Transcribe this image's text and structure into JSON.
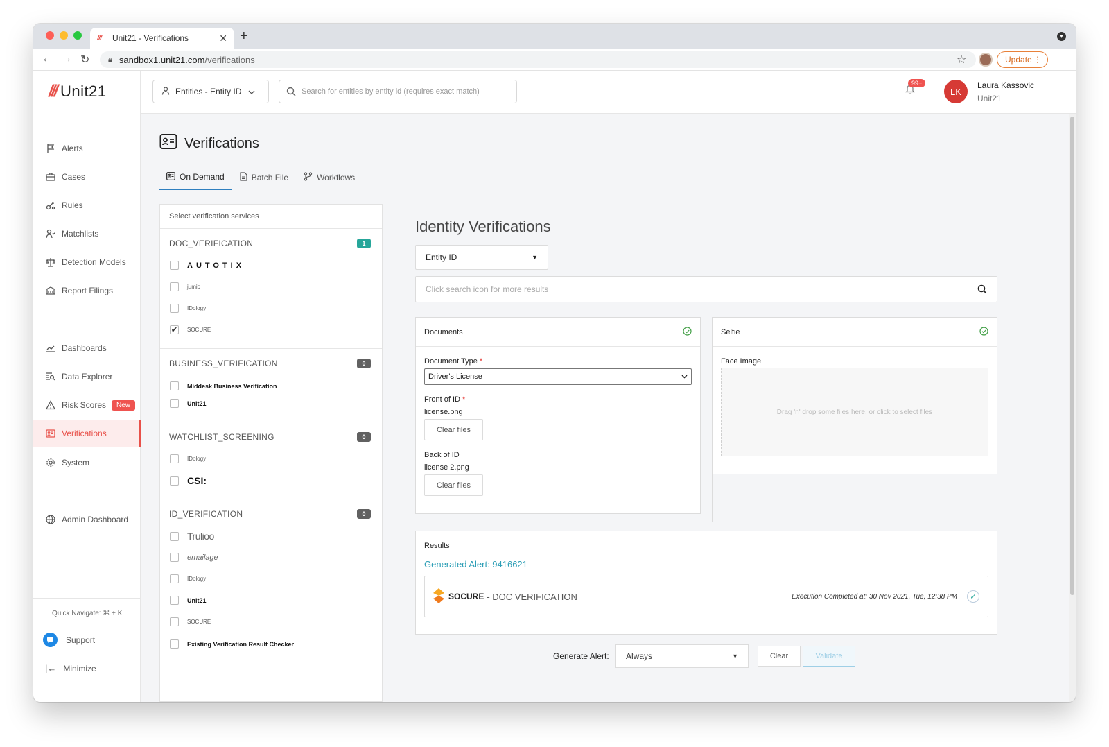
{
  "browser": {
    "tab_title": "Unit21 - Verifications",
    "tab_favicon": "///",
    "url_host": "sandbox1.unit21.com",
    "url_path": "/verifications",
    "update_label": "Update"
  },
  "brand": {
    "mark": "///",
    "name": "Unit21",
    "accent": "#e8514a"
  },
  "sidebar": {
    "items": [
      {
        "label": "Alerts",
        "icon": "flag-icon"
      },
      {
        "label": "Cases",
        "icon": "briefcase-icon"
      },
      {
        "label": "Rules",
        "icon": "rules-icon"
      },
      {
        "label": "Matchlists",
        "icon": "user-check-icon"
      },
      {
        "label": "Detection Models",
        "icon": "scale-icon"
      },
      {
        "label": "Report Filings",
        "icon": "building-icon"
      },
      {
        "label": "Dashboards",
        "icon": "chart-icon"
      },
      {
        "label": "Data Explorer",
        "icon": "data-search-icon"
      },
      {
        "label": "Risk Scores",
        "icon": "warning-icon",
        "badge": "New"
      },
      {
        "label": "Verifications",
        "icon": "id-card-icon"
      },
      {
        "label": "System",
        "icon": "gear-icon"
      },
      {
        "label": "Admin Dashboard",
        "icon": "globe-icon"
      }
    ],
    "quick_navigate": "Quick Navigate: ⌘ + K",
    "support": "Support",
    "minimize": "Minimize"
  },
  "topbar": {
    "entity_select": "Entities - Entity ID",
    "search_placeholder": "Search for entities by entity id (requires exact match)",
    "notifications": "99+",
    "user_initials": "LK",
    "user_name": "Laura Kassovic",
    "user_org": "Unit21"
  },
  "page": {
    "title": "Verifications",
    "tabs": [
      "On Demand",
      "Batch File",
      "Workflows"
    ]
  },
  "services": {
    "header": "Select verification services",
    "groups": [
      {
        "name": "DOC_VERIFICATION",
        "count": "1",
        "options": [
          {
            "vendor": "AUTOTIX",
            "checked": false
          },
          {
            "vendor": "jumio",
            "checked": false
          },
          {
            "vendor": "IDology",
            "checked": false
          },
          {
            "vendor": "SOCURE",
            "checked": true
          }
        ]
      },
      {
        "name": "BUSINESS_VERIFICATION",
        "count": "0",
        "options": [
          {
            "vendor": "Middesk Business Verification",
            "checked": false
          },
          {
            "vendor": "Unit21",
            "checked": false
          }
        ]
      },
      {
        "name": "WATCHLIST_SCREENING",
        "count": "0",
        "options": [
          {
            "vendor": "IDology",
            "checked": false
          },
          {
            "vendor": "CSI:",
            "checked": false
          }
        ]
      },
      {
        "name": "ID_VERIFICATION",
        "count": "0",
        "options": [
          {
            "vendor": "Trulioo",
            "checked": false
          },
          {
            "vendor": "emailage",
            "checked": false
          },
          {
            "vendor": "IDology",
            "checked": false
          },
          {
            "vendor": "Unit21",
            "checked": false
          },
          {
            "vendor": "SOCURE",
            "checked": false
          },
          {
            "vendor": "Existing Verification Result Checker",
            "checked": false
          }
        ]
      }
    ]
  },
  "identity": {
    "title": "Identity Verifications",
    "id_type": "Entity ID",
    "search_placeholder": "Click search icon for more results",
    "documents": {
      "title": "Documents",
      "doc_type_label": "Document Type",
      "doc_type_value": "Driver's License",
      "front_label": "Front of ID",
      "front_file": "license.png",
      "back_label": "Back of ID",
      "back_file": "license 2.png",
      "clear_label": "Clear files",
      "required_mark": "*"
    },
    "selfie": {
      "title": "Selfie",
      "face_label": "Face Image",
      "dropzone": "Drag 'n' drop some files here, or click to select files"
    },
    "results": {
      "title": "Results",
      "alert_link": "Generated Alert: 9416621",
      "vendor": "SOCURE",
      "service": "- DOC VERIFICATION",
      "execution": "Execution Completed at: 30 Nov 2021, Tue, 12:38 PM"
    }
  },
  "footer": {
    "generate_label": "Generate Alert:",
    "generate_value": "Always",
    "clear": "Clear",
    "validate": "Validate"
  }
}
